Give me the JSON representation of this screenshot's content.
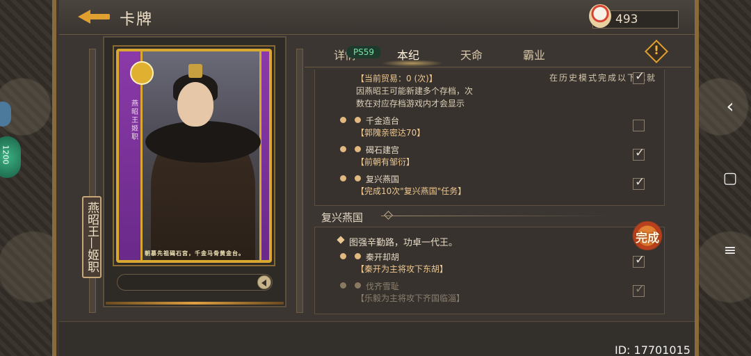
{
  "header": {
    "title": "卡牌",
    "currency_value": "493"
  },
  "card": {
    "name_vertical": "燕昭王—姬职",
    "caption": "朝慕先祖碣石宫，千金马骨黄金台。",
    "side_name": "燕昭王",
    "side_label": "姬职"
  },
  "tabs": [
    {
      "label": "详情"
    },
    {
      "label": "本纪"
    },
    {
      "label": "天命"
    },
    {
      "label": "霸业"
    }
  ],
  "ps_badge": "PS59",
  "history_note": "在历史模式完成以下成就",
  "section1": {
    "trade_count": "【当前贸易：0 (次)】",
    "note_line1": "因燕昭王可能新建多个存档，次",
    "note_line2": "数在对应存档游戏内才会显示",
    "items": [
      {
        "title": "千金造台",
        "requirement": "【郭隗亲密达70】",
        "checked": false
      },
      {
        "title": "碣石建宫",
        "requirement": "【前朝有邹衍】",
        "checked": true
      },
      {
        "title": "复兴燕国",
        "requirement": "【完成10次\"复兴燕国\"任务】",
        "checked": true
      }
    ]
  },
  "section2": {
    "header": "复兴燕国",
    "motto": "图强辛勤路，功卓一代王。",
    "complete_label": "完成",
    "items": [
      {
        "title": "秦开却胡",
        "requirement": "【秦开为主将攻下东胡】",
        "checked": true,
        "dim": false
      },
      {
        "title": "伐齐雪耻",
        "requirement": "【乐毅为主将攻下齐国临淄】",
        "checked": true,
        "dim": true
      }
    ]
  },
  "footer": {
    "player_id": "ID: 17701015"
  },
  "android_nav": {
    "back": "‹",
    "home": "▢",
    "menu": "≡"
  },
  "side_widget": "1200",
  "colors": {
    "accent_gold": "#e0a030",
    "card_purple": "#8a3aa8",
    "complete_red": "#b8401c"
  }
}
